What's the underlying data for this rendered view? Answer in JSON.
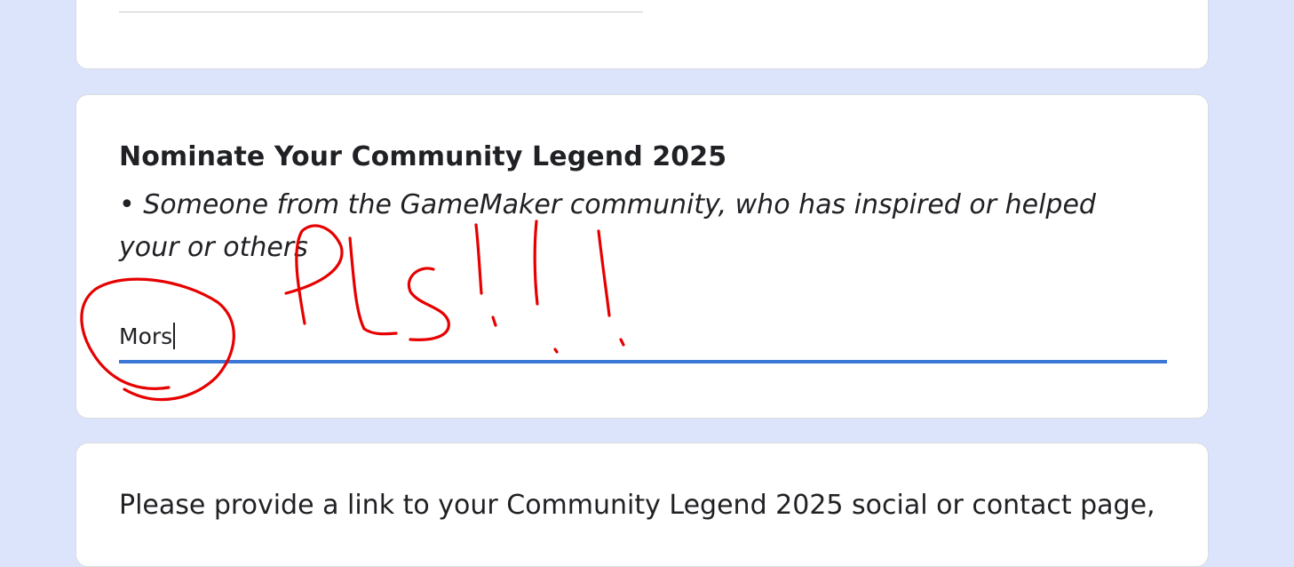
{
  "question": {
    "title": "Nominate Your Community Legend 2025",
    "description": "• Someone from the GameMaker community, who has inspired or helped your or others",
    "answer_value": "Mors"
  },
  "next_question": {
    "text": "Please provide a link to your Community Legend 2025 social or contact page,"
  },
  "annotation": {
    "handwritten_text": "PLS!!!",
    "color": "#e60000"
  },
  "colors": {
    "page_background": "#dbe4fb",
    "active_underline": "#3b78d6"
  }
}
